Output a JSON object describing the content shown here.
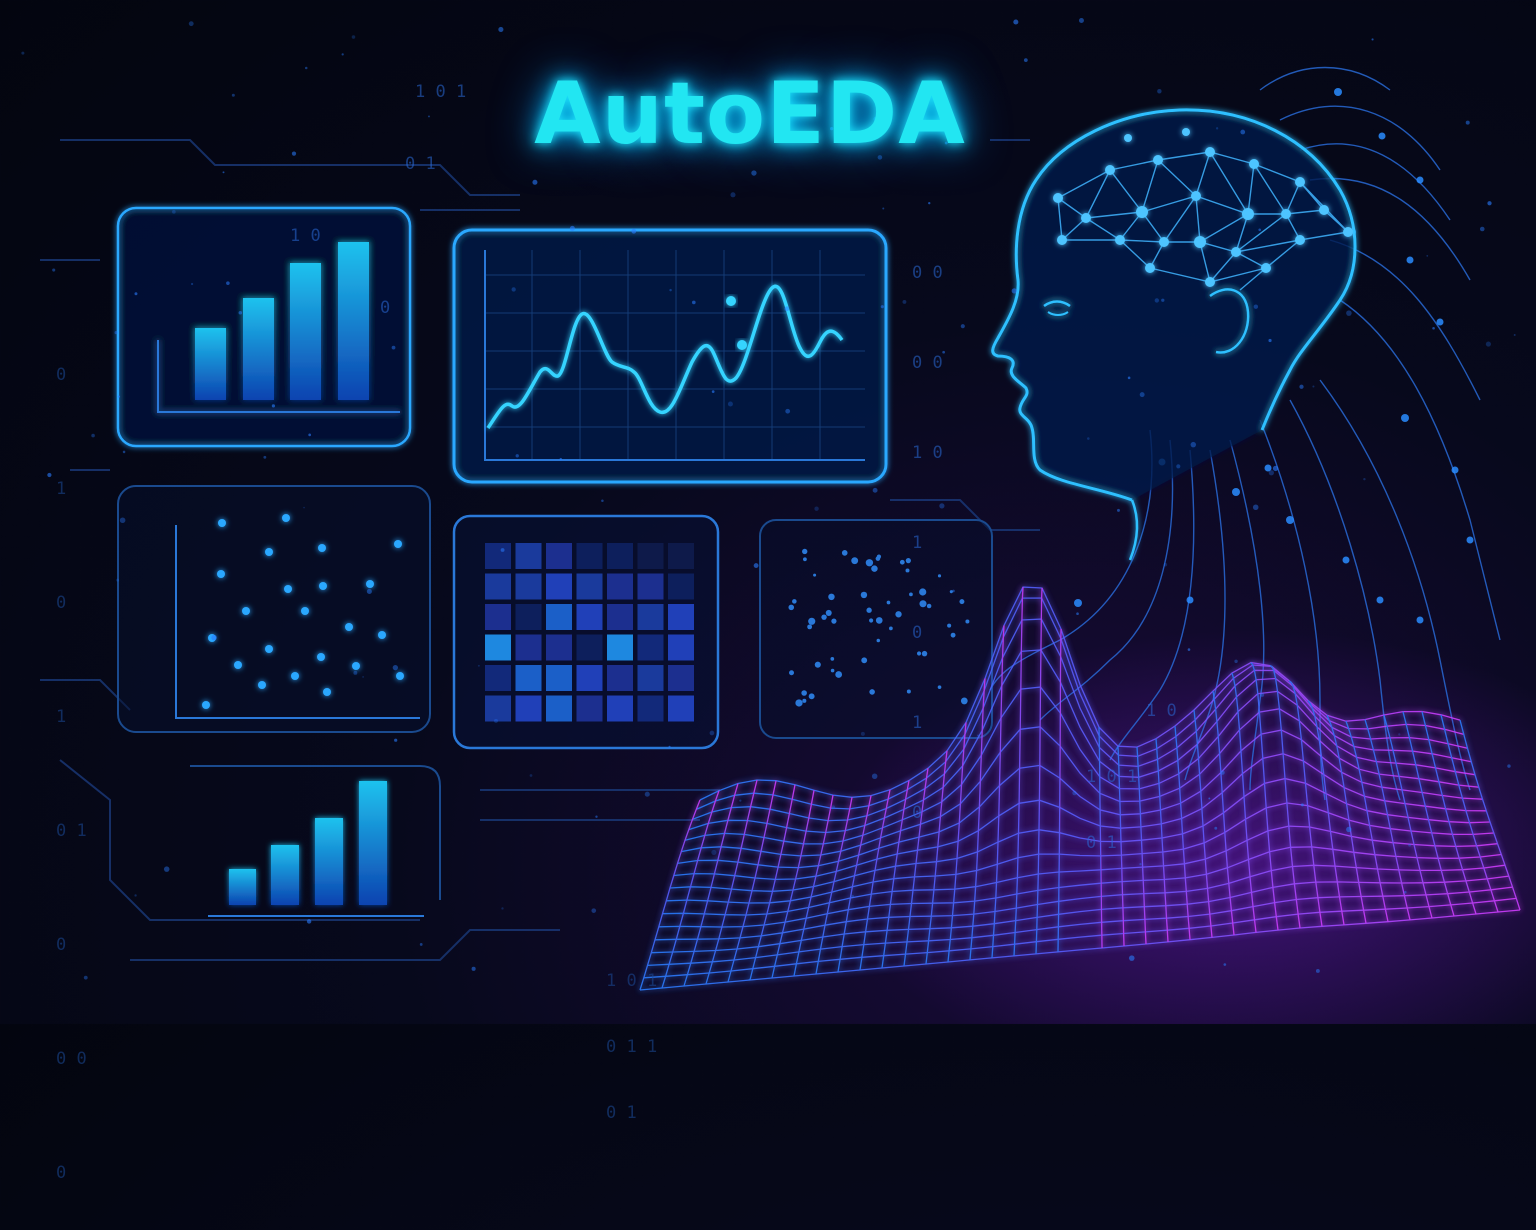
{
  "title": "AutoEDA",
  "colors": {
    "title": "#22e6f2",
    "panel_stroke": "#2aa8ff",
    "chart_line": "#35d4ff",
    "bar_top": "#1fc2ee",
    "bar_bottom": "#0d43b0",
    "accent_magenta": "#c03cf0",
    "background": "#05071a"
  },
  "binary_strings": [
    "0",
    "1 0",
    "0 1",
    "1 0 1",
    "0 1 1",
    "1",
    "0 0"
  ],
  "panels": {
    "bar_chart_top": {
      "icon": "bar-chart-icon",
      "bar_levels": [
        0.42,
        0.62,
        0.8,
        1.0
      ]
    },
    "line_chart": {
      "icon": "line-chart-icon"
    },
    "scatter_plot": {
      "icon": "scatter-plot-icon"
    },
    "heatmap": {
      "icon": "heatmap-icon"
    },
    "dot_grid": {
      "icon": "dot-grid-icon"
    },
    "bar_chart_bottom": {
      "icon": "bar-chart-icon",
      "bar_levels": [
        0.3,
        0.48,
        0.7,
        1.0
      ]
    }
  },
  "figure": {
    "icon": "ai-head-network-icon"
  },
  "surface": {
    "icon": "wireframe-wave-icon"
  }
}
